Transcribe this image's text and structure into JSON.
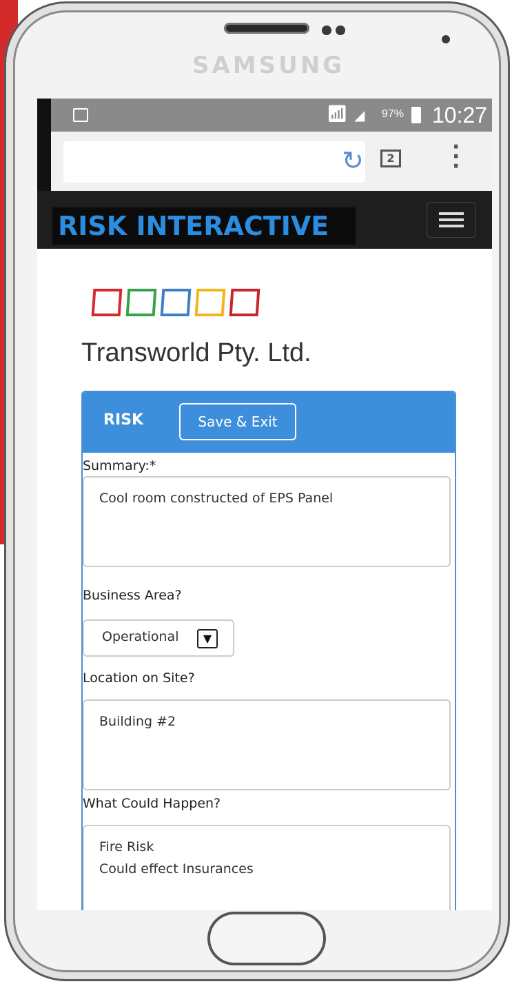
{
  "device": {
    "brand": "SAMSUNG"
  },
  "status_bar": {
    "battery_percent": "97%",
    "time": "10:27"
  },
  "browser": {
    "tab_count": "2"
  },
  "navbar": {
    "logo": "RISK INTERACTIVE",
    "menu_icon": "hamburger-icon"
  },
  "logo_squares": {
    "colors": [
      "#d7282f",
      "#3aa14a",
      "#3d7fc9",
      "#f2b51c",
      "#c8252b"
    ]
  },
  "company_name": "Transworld Pty. Ltd.",
  "card": {
    "title": "RISK",
    "save_label": "Save & Exit",
    "summary": {
      "label": "Summary:*",
      "value": "Cool room constructed of EPS Panel"
    },
    "business_area": {
      "label": "Business Area?",
      "value": "Operational"
    },
    "location": {
      "label": "Location on Site?",
      "value": "Building #2"
    },
    "what_could_happen": {
      "label": "What Could Happen?",
      "value": "Fire Risk\nCould effect Insurances"
    }
  },
  "colors": {
    "accent": "#3d8fdc",
    "logo_text": "#2b8de0"
  }
}
